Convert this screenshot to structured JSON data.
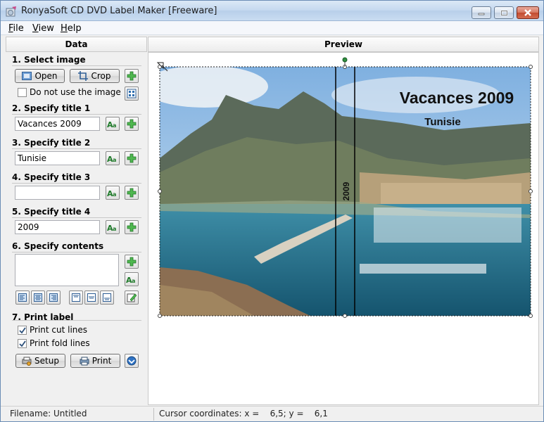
{
  "window": {
    "title": "RonyaSoft CD DVD Label Maker [Freeware]"
  },
  "menu": [
    {
      "label": "File",
      "mnemonic": "F",
      "rest": "ile"
    },
    {
      "label": "View",
      "mnemonic": "V",
      "rest": "iew"
    },
    {
      "label": "Help",
      "mnemonic": "H",
      "rest": "elp"
    }
  ],
  "panels": {
    "data": "Data",
    "preview": "Preview"
  },
  "sections": {
    "select_image": "1. Select image",
    "title1": "2. Specify title 1",
    "title2": "3. Specify title 2",
    "title3": "4. Specify title 3",
    "title4": "5. Specify title 4",
    "contents": "6. Specify contents",
    "print": "7. Print label"
  },
  "buttons": {
    "open": "Open",
    "crop": "Crop",
    "setup": "Setup",
    "print": "Print"
  },
  "checkboxes": {
    "no_image": {
      "label": "Do not use the image",
      "checked": false
    },
    "cut_lines": {
      "label": "Print cut lines",
      "checked": true
    },
    "fold_lines": {
      "label": "Print fold lines",
      "checked": true
    }
  },
  "inputs": {
    "title1": "Vacances 2009",
    "title2": "Tunisie",
    "title3": "",
    "title4": "2009",
    "contents": ""
  },
  "preview": {
    "title1": "Vacances 2009",
    "title2": "Tunisie",
    "spine": "2009"
  },
  "status": {
    "filename": "Filename: Untitled",
    "cursor": "Cursor coordinates: x =    6,5; y =    6,1"
  },
  "icons": {
    "add": "green-plus-icon",
    "font": "font-style-icon",
    "align": "text-align-icon",
    "edit": "edit-icon",
    "layout": "layout-icon",
    "setup": "printer-setup-icon",
    "print": "printer-icon",
    "update": "update-icon"
  },
  "colors": {
    "accent_green": "#3aa33a",
    "title_text": "#111111",
    "sea": "#1f6f8b",
    "sky": "#9cc3e6"
  }
}
